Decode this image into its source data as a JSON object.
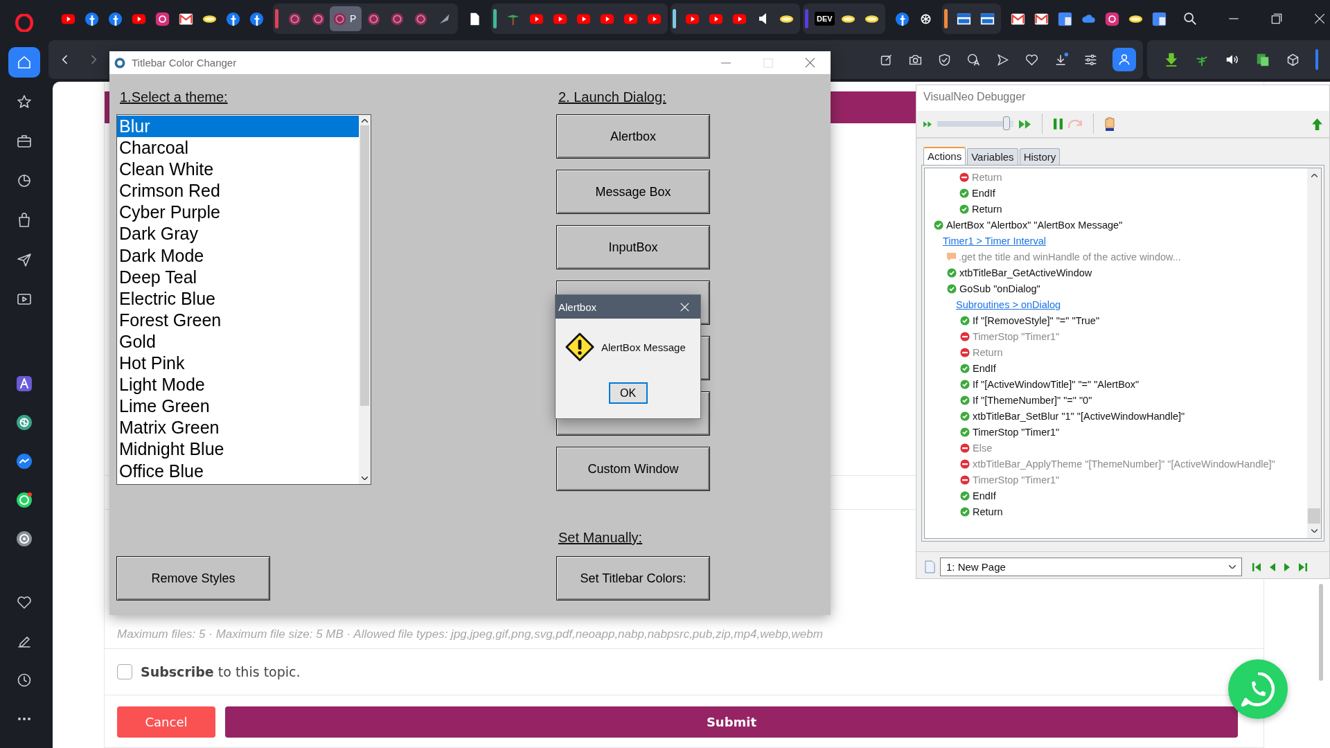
{
  "sidebar": {
    "sections": [
      {
        "items": [
          {
            "kind": "home",
            "selected": true
          },
          {
            "kind": "star",
            "selected": false
          },
          {
            "kind": "briefcase",
            "selected": false
          },
          {
            "kind": "history",
            "selected": false
          },
          {
            "kind": "bag",
            "selected": false
          },
          {
            "kind": "plane",
            "selected": false
          },
          {
            "kind": "player",
            "selected": false
          }
        ]
      },
      {
        "items": [
          {
            "kind": "aria",
            "selected": false
          },
          {
            "kind": "chatgpt",
            "selected": false
          },
          {
            "kind": "messenger",
            "selected": false
          },
          {
            "kind": "whatsapp",
            "selected": false
          },
          {
            "kind": "music",
            "selected": false
          }
        ]
      },
      {
        "items": [
          {
            "kind": "heart",
            "selected": false
          },
          {
            "kind": "edit",
            "selected": false
          },
          {
            "kind": "clock",
            "selected": false
          },
          {
            "kind": "more",
            "selected": false
          }
        ]
      }
    ]
  },
  "tab_strip": [
    {
      "tabs": [
        {
          "kind": "youtube",
          "selected": false
        },
        {
          "kind": "facebook",
          "selected": false
        },
        {
          "kind": "facebook",
          "selected": false
        },
        {
          "kind": "youtube",
          "selected": false
        },
        {
          "kind": "instagram",
          "selected": false
        },
        {
          "kind": "mail",
          "selected": false
        },
        {
          "kind": "pill",
          "selected": false
        },
        {
          "kind": "facebook",
          "selected": false
        },
        {
          "kind": "facebook",
          "selected": false
        }
      ]
    },
    {
      "color": "#e0405a",
      "tabs": [
        {
          "kind": "ring",
          "selected": false
        },
        {
          "kind": "ring",
          "selected": false
        },
        {
          "kind": "ring",
          "selected": true,
          "text": "P"
        },
        {
          "kind": "ring",
          "selected": false
        },
        {
          "kind": "ring",
          "selected": false
        },
        {
          "kind": "ring",
          "selected": false
        },
        {
          "kind": "feather",
          "selected": false
        }
      ]
    },
    {
      "tabs": [
        {
          "kind": "doc",
          "selected": false
        }
      ]
    },
    {
      "color": "#3fb89a",
      "tabs": [
        {
          "kind": "palm",
          "selected": false
        },
        {
          "kind": "youtube",
          "selected": false
        },
        {
          "kind": "youtube",
          "selected": false
        },
        {
          "kind": "youtube",
          "selected": false
        },
        {
          "kind": "youtube",
          "selected": false
        },
        {
          "kind": "youtube",
          "selected": false
        },
        {
          "kind": "youtube",
          "selected": false
        }
      ]
    },
    {
      "color": "#7ec8e3",
      "tabs": [
        {
          "kind": "youtube",
          "selected": false
        },
        {
          "kind": "youtube",
          "selected": false
        },
        {
          "kind": "youtube",
          "selected": false
        },
        {
          "kind": "speaker",
          "selected": false
        },
        {
          "kind": "pill",
          "selected": false
        }
      ]
    },
    {
      "color": "#5b3be0",
      "tabs": [
        {
          "kind": "dev",
          "selected": false,
          "text": "DEV"
        },
        {
          "kind": "pill",
          "selected": false
        },
        {
          "kind": "pill",
          "selected": false
        }
      ]
    },
    {
      "tabs": [
        {
          "kind": "facebook",
          "selected": false
        },
        {
          "kind": "knot",
          "selected": false
        }
      ]
    },
    {
      "color": "#f08a3c",
      "tabs": [
        {
          "kind": "window",
          "selected": false
        },
        {
          "kind": "window",
          "selected": false
        }
      ]
    },
    {
      "tabs": [
        {
          "kind": "mail",
          "selected": false
        },
        {
          "kind": "mail",
          "selected": false
        },
        {
          "kind": "translate",
          "selected": false
        },
        {
          "kind": "cloud",
          "selected": false
        },
        {
          "kind": "instagram",
          "selected": false
        },
        {
          "kind": "pill",
          "selected": false
        },
        {
          "kind": "translate",
          "selected": false
        }
      ]
    }
  ],
  "page": {
    "hint": "Maximum files: 5 · Maximum file size: 5 MB · Allowed file types: jpg,jpeg,gif,png,svg,pdf,neoapp,nabp,nabpsrc,pub,zip,mp4,webp,webm",
    "subscribe": {
      "text": "**Subscribe** to this topic.",
      "checked": false
    },
    "cancel": "Cancel",
    "submit": "Submit"
  },
  "changer": {
    "title": "Titlebar Color Changer",
    "theme_heading": "1.Select a theme:",
    "themes": [
      {
        "label": "Blur",
        "selected": true
      },
      {
        "label": "Charcoal",
        "selected": false
      },
      {
        "label": "Clean White",
        "selected": false
      },
      {
        "label": "Crimson Red",
        "selected": false
      },
      {
        "label": "Cyber Purple",
        "selected": false
      },
      {
        "label": "Dark Gray",
        "selected": false
      },
      {
        "label": "Dark Mode",
        "selected": false
      },
      {
        "label": "Deep Teal",
        "selected": false
      },
      {
        "label": "Electric Blue",
        "selected": false
      },
      {
        "label": "Forest Green",
        "selected": false
      },
      {
        "label": "Gold",
        "selected": false
      },
      {
        "label": "Hot Pink",
        "selected": false
      },
      {
        "label": "Light Mode",
        "selected": false
      },
      {
        "label": "Lime Green",
        "selected": false
      },
      {
        "label": "Matrix Green",
        "selected": false
      },
      {
        "label": "Midnight Blue",
        "selected": false
      },
      {
        "label": "Office Blue",
        "selected": false
      }
    ],
    "dialog_heading": "2. Launch Dialog:",
    "dialog_buttons": [
      {
        "kind": "labeled",
        "label": "Alertbox"
      },
      {
        "kind": "labeled",
        "label": "Message Box"
      },
      {
        "kind": "labeled",
        "label": "InputBox"
      },
      {
        "kind": "covered"
      },
      {
        "kind": "covered"
      },
      {
        "kind": "covered"
      },
      {
        "kind": "labeled",
        "label": "Custom Window"
      }
    ],
    "remove_button": "Remove Styles",
    "manual_heading": "Set Manually:",
    "manual_button": "Set Titlebar Colors:"
  },
  "alert": {
    "title": "Alertbox",
    "message": "AlertBox Message",
    "ok": "OK"
  },
  "debugger": {
    "title": "VisualNeo Debugger",
    "speed": {
      "level": 0.95
    },
    "tabs": [
      {
        "label": "Actions",
        "selected": true
      },
      {
        "label": "Variables",
        "selected": false
      },
      {
        "label": "History",
        "selected": false
      }
    ],
    "earlier_lines": [
      {
        "kind": "action",
        "executed": false,
        "text": "Return"
      },
      {
        "kind": "action",
        "executed": true,
        "text": "EndIf"
      },
      {
        "kind": "action",
        "executed": true,
        "text": "Return"
      }
    ],
    "log": [
      {
        "kind": "action",
        "executed": true,
        "text": "AlertBox \"Alertbox\" \"AlertBox Message\"",
        "children": [
          {
            "kind": "link",
            "text": "Timer1 > Timer Interval",
            "children": [
              {
                "kind": "comment",
                "text": ".get the title and winHandle of the active window..."
              },
              {
                "kind": "action",
                "executed": true,
                "text": "xtbTitleBar_GetActiveWindow"
              },
              {
                "kind": "action",
                "executed": true,
                "text": "GoSub \"onDialog\"",
                "children": [
                  {
                    "kind": "link",
                    "text": "Subroutines > onDialog",
                    "children": [
                      {
                        "kind": "action",
                        "executed": true,
                        "text": "If \"[RemoveStyle]\" \"=\" \"True\""
                      },
                      {
                        "kind": "action",
                        "executed": false,
                        "text": "TimerStop \"Timer1\""
                      },
                      {
                        "kind": "action",
                        "executed": false,
                        "text": "Return"
                      },
                      {
                        "kind": "action",
                        "executed": true,
                        "text": "EndIf"
                      },
                      {
                        "kind": "action",
                        "executed": true,
                        "text": "If \"[ActiveWindowTitle]\" \"=\" \"AlertBox\""
                      },
                      {
                        "kind": "action",
                        "executed": true,
                        "text": "If \"[ThemeNumber]\" \"=\" \"0\""
                      },
                      {
                        "kind": "action",
                        "executed": true,
                        "text": "xtbTitleBar_SetBlur \"1\" \"[ActiveWindowHandle]\""
                      },
                      {
                        "kind": "action",
                        "executed": true,
                        "text": "TimerStop \"Timer1\""
                      },
                      {
                        "kind": "action",
                        "executed": false,
                        "text": "Else"
                      },
                      {
                        "kind": "action",
                        "executed": false,
                        "text": "xtbTitleBar_ApplyTheme \"[ThemeNumber]\" \"[ActiveWindowHandle]\""
                      },
                      {
                        "kind": "action",
                        "executed": false,
                        "text": "TimerStop \"Timer1\""
                      },
                      {
                        "kind": "action",
                        "executed": true,
                        "text": "EndIf"
                      },
                      {
                        "kind": "action",
                        "executed": true,
                        "text": "Return"
                      }
                    ]
                  }
                ]
              }
            ]
          }
        ]
      }
    ],
    "page_select": "1: New Page"
  }
}
